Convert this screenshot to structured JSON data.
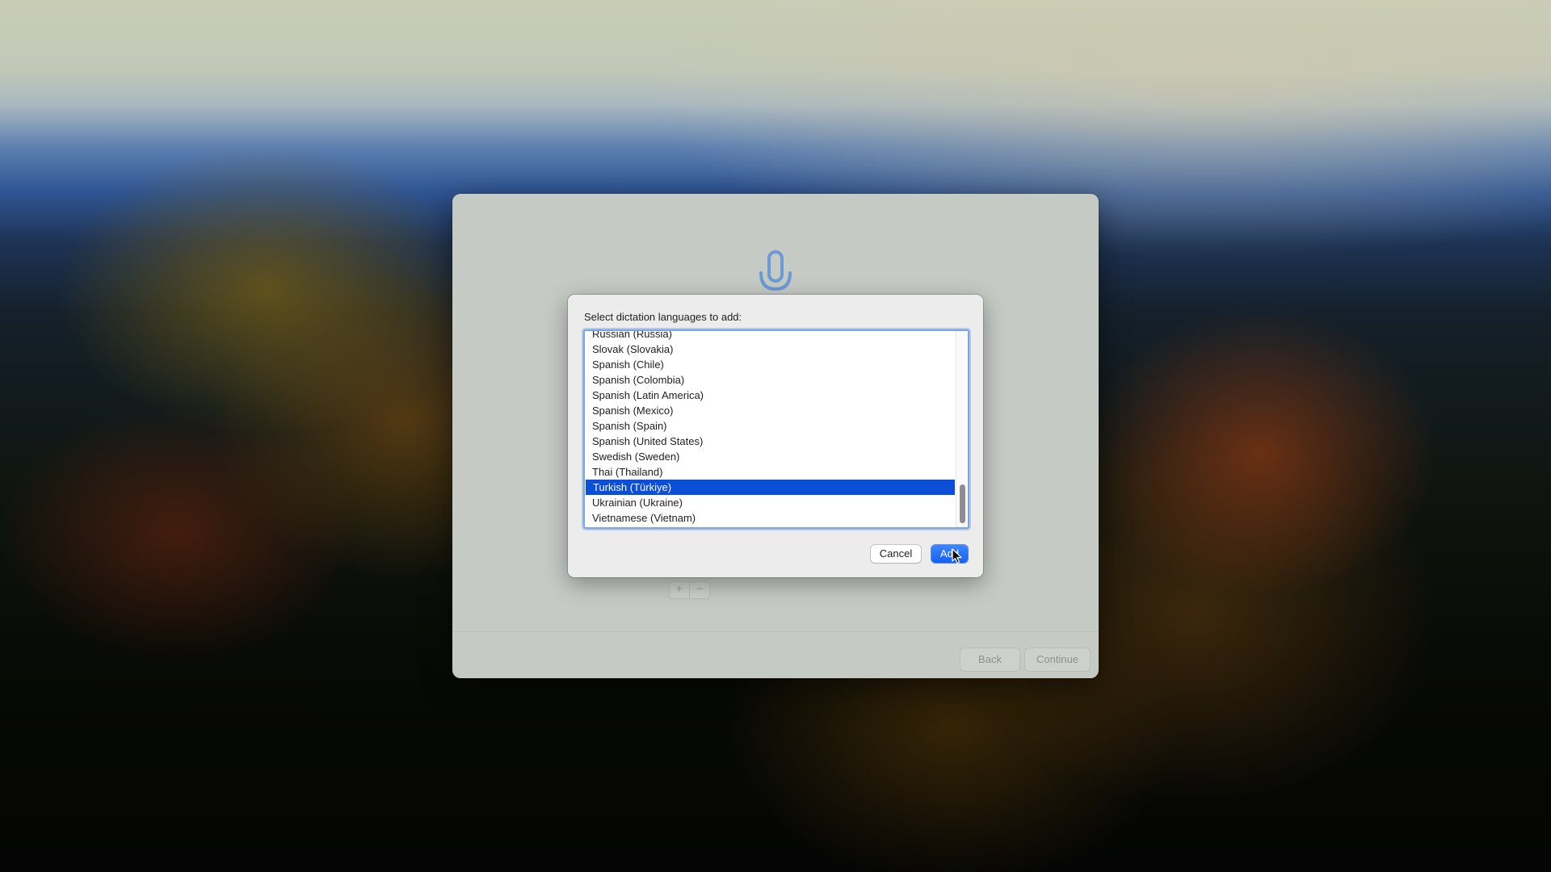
{
  "setup_window": {
    "list_add_symbol": "+",
    "list_remove_symbol": "−",
    "back_label": "Back",
    "continue_label": "Continue",
    "header_icon": "microphone-icon"
  },
  "sheet": {
    "prompt": "Select dictation languages to add:",
    "languages": [
      {
        "label": "Russian (Russia)",
        "selected": false
      },
      {
        "label": "Slovak (Slovakia)",
        "selected": false
      },
      {
        "label": "Spanish (Chile)",
        "selected": false
      },
      {
        "label": "Spanish (Colombia)",
        "selected": false
      },
      {
        "label": "Spanish (Latin America)",
        "selected": false
      },
      {
        "label": "Spanish (Mexico)",
        "selected": false
      },
      {
        "label": "Spanish (Spain)",
        "selected": false
      },
      {
        "label": "Spanish (United States)",
        "selected": false
      },
      {
        "label": "Swedish (Sweden)",
        "selected": false
      },
      {
        "label": "Thai (Thailand)",
        "selected": false
      },
      {
        "label": "Turkish (Türkiye)",
        "selected": true
      },
      {
        "label": "Ukrainian (Ukraine)",
        "selected": false
      },
      {
        "label": "Vietnamese (Vietnam)",
        "selected": false
      }
    ],
    "cancel_label": "Cancel",
    "add_label": "Add"
  },
  "colors": {
    "selection": "#0b4fd8",
    "accent_button": "#1462f0"
  }
}
